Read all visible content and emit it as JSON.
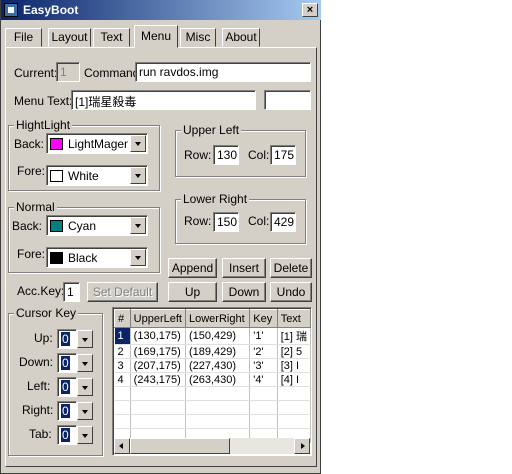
{
  "window": {
    "title": "EasyBoot",
    "close_glyph": "×"
  },
  "tabs": [
    {
      "label": "File"
    },
    {
      "label": "Layout"
    },
    {
      "label": "Text"
    },
    {
      "label": "Menu"
    },
    {
      "label": "Misc"
    },
    {
      "label": "About"
    }
  ],
  "active_tab": "Menu",
  "current": {
    "label": "Current:",
    "value": "1"
  },
  "command": {
    "label": "Command:",
    "value": "run ravdos.img"
  },
  "menu_text": {
    "label": "Menu Text:",
    "value": "[1]瑞星殺毒",
    "extra_value": ""
  },
  "highlight": {
    "title": "HightLight",
    "back": {
      "label": "Back:",
      "value": "LightMagenta",
      "color": "#ff00ff"
    },
    "fore": {
      "label": "Fore:",
      "value": "White",
      "color": "#ffffff"
    }
  },
  "normal": {
    "title": "Normal",
    "back": {
      "label": "Back:",
      "value": "Cyan",
      "color": "#008080"
    },
    "fore": {
      "label": "Fore:",
      "value": "Black",
      "color": "#000000"
    }
  },
  "upper_left": {
    "title": "Upper Left",
    "row_label": "Row:",
    "row": "130",
    "col_label": "Col:",
    "col": "175"
  },
  "lower_right": {
    "title": "Lower Right",
    "row_label": "Row:",
    "row": "150",
    "col_label": "Col:",
    "col": "429"
  },
  "buttons": {
    "append": "Append",
    "insert": "Insert",
    "delete": "Delete",
    "set_default": "Set Default",
    "up": "Up",
    "down": "Down",
    "undo": "Undo"
  },
  "acc_key": {
    "label": "Acc.Key:",
    "value": "1"
  },
  "cursor_key": {
    "title": "Cursor Key",
    "up": {
      "label": "Up:",
      "value": "0"
    },
    "down": {
      "label": "Down:",
      "value": "0"
    },
    "left": {
      "label": "Left:",
      "value": "0"
    },
    "right": {
      "label": "Right:",
      "value": "0"
    },
    "tab": {
      "label": "Tab:",
      "value": "0"
    }
  },
  "table": {
    "columns": [
      "#",
      "UpperLeft",
      "LowerRight",
      "Key",
      "Text"
    ],
    "rows": [
      [
        "1",
        "(130,175)",
        "(150,429)",
        "'1'",
        "[1] 瑞"
      ],
      [
        "2",
        "(169,175)",
        "(189,429)",
        "'2'",
        "[2] 5"
      ],
      [
        "3",
        "(207,175)",
        "(227,430)",
        "'3'",
        "[3] I"
      ],
      [
        "4",
        "(243,175)",
        "(263,430)",
        "'4'",
        "[4] I"
      ]
    ]
  }
}
